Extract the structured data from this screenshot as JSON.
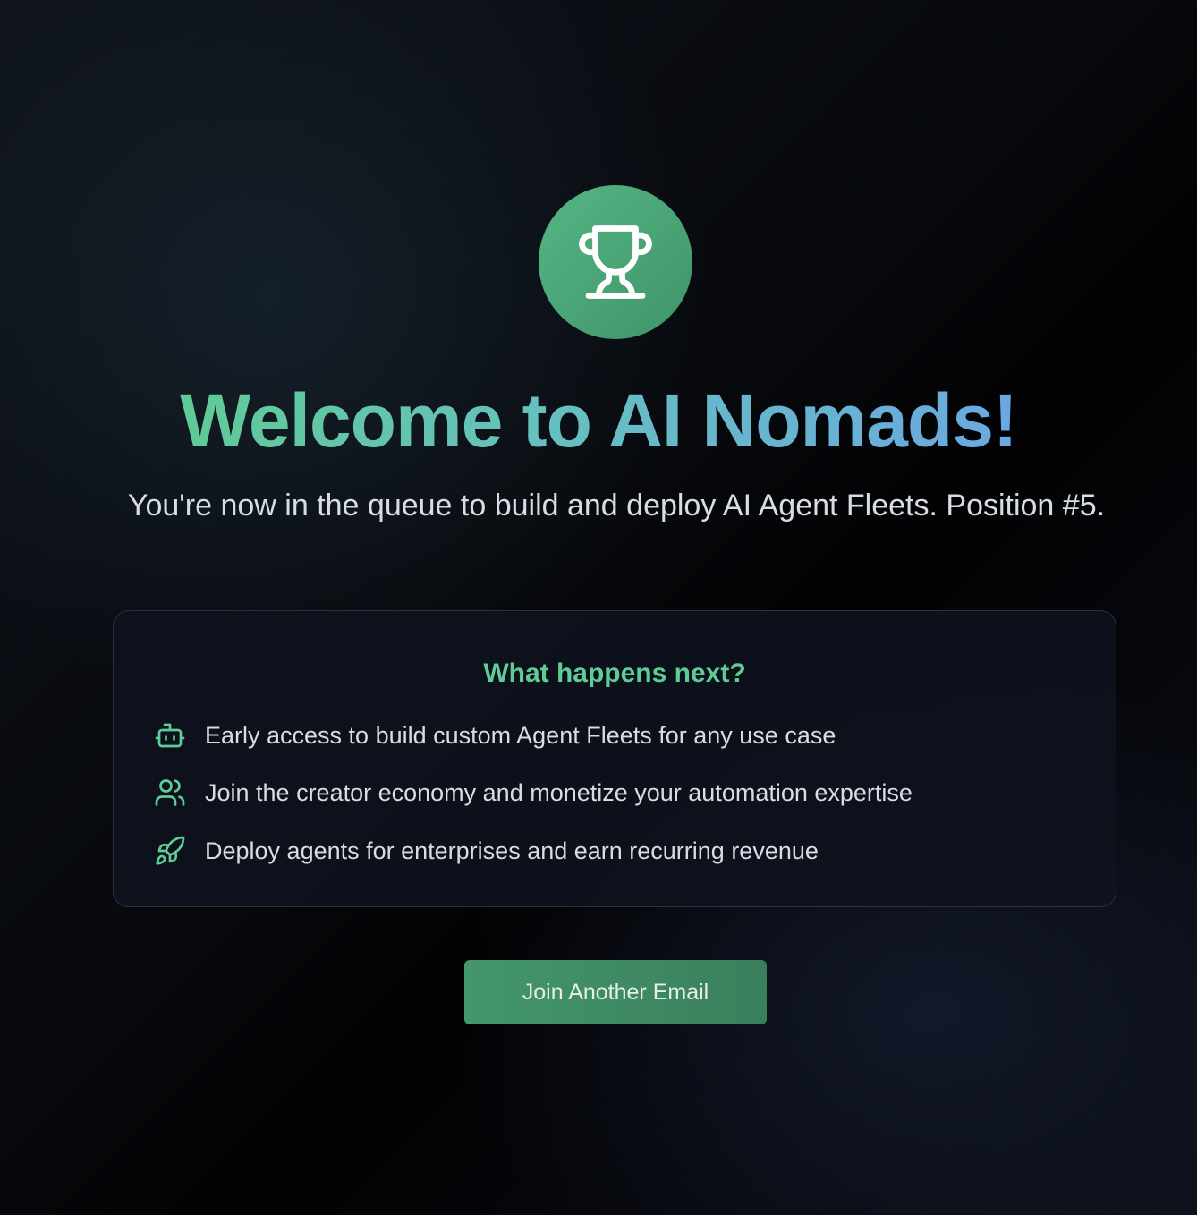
{
  "hero": {
    "icon": "trophy-icon",
    "title": "Welcome to AI Nomads!",
    "subtitle": "You're now in the queue to build and deploy AI Agent Fleets. Position #5."
  },
  "next_steps": {
    "title": "What happens next?",
    "items": [
      {
        "icon": "bot-icon",
        "text": "Early access to build custom Agent Fleets for any use case"
      },
      {
        "icon": "users-icon",
        "text": "Join the creator economy and monetize your automation expertise"
      },
      {
        "icon": "rocket-icon",
        "text": "Deploy agents for enterprises and earn recurring revenue"
      }
    ]
  },
  "actions": {
    "join_another_label": "Join Another Email"
  },
  "colors": {
    "accent_green": "#5fcb96",
    "accent_blue": "#6aa8e2",
    "button_green": "#44966b"
  }
}
